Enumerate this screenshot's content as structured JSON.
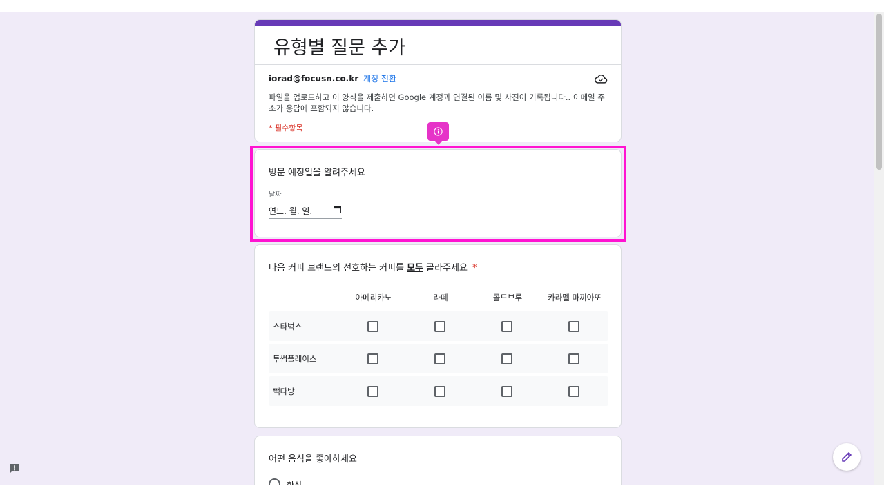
{
  "form": {
    "title": "유형별 질문 추가",
    "account_email": "iorad@focusn.co.kr",
    "switch_account": "계정 전환",
    "notice": "파일을 업로드하고 이 양식을 제출하면 Google 계정과 연결된 이름 및 사진이 기록됩니다.. 이메일 주소가 응답에 포함되지 않습니다.",
    "required_note": "* 필수항목"
  },
  "questions": {
    "visit_date": {
      "title": "방문 예정일을 알려주세요",
      "field_label": "날짜",
      "placeholder": "연도. 월. 일."
    },
    "coffee": {
      "title_before": "다음 커피 브랜드의 선호하는 커피를",
      "title_emphasis": "모두",
      "title_after": "골라주세요",
      "required_mark": "*",
      "columns": [
        "아메리카노",
        "라떼",
        "콜드브루",
        "카라멜 마끼아또"
      ],
      "rows": [
        "스타벅스",
        "투썸플레이스",
        "빽다방"
      ]
    },
    "food": {
      "title": "어떤 음식을 좋아하세요",
      "options": [
        "한식"
      ]
    }
  },
  "icons": {
    "cloud": "cloud-check-icon",
    "info": "info-icon",
    "calendar": "calendar-icon",
    "feedback": "feedback-icon",
    "edit": "pencil-icon"
  },
  "colors": {
    "background": "#f0ebf8",
    "accent": "#673ab7",
    "highlight": "#ff13d1",
    "link": "#1a73e8",
    "required": "#d93025"
  }
}
